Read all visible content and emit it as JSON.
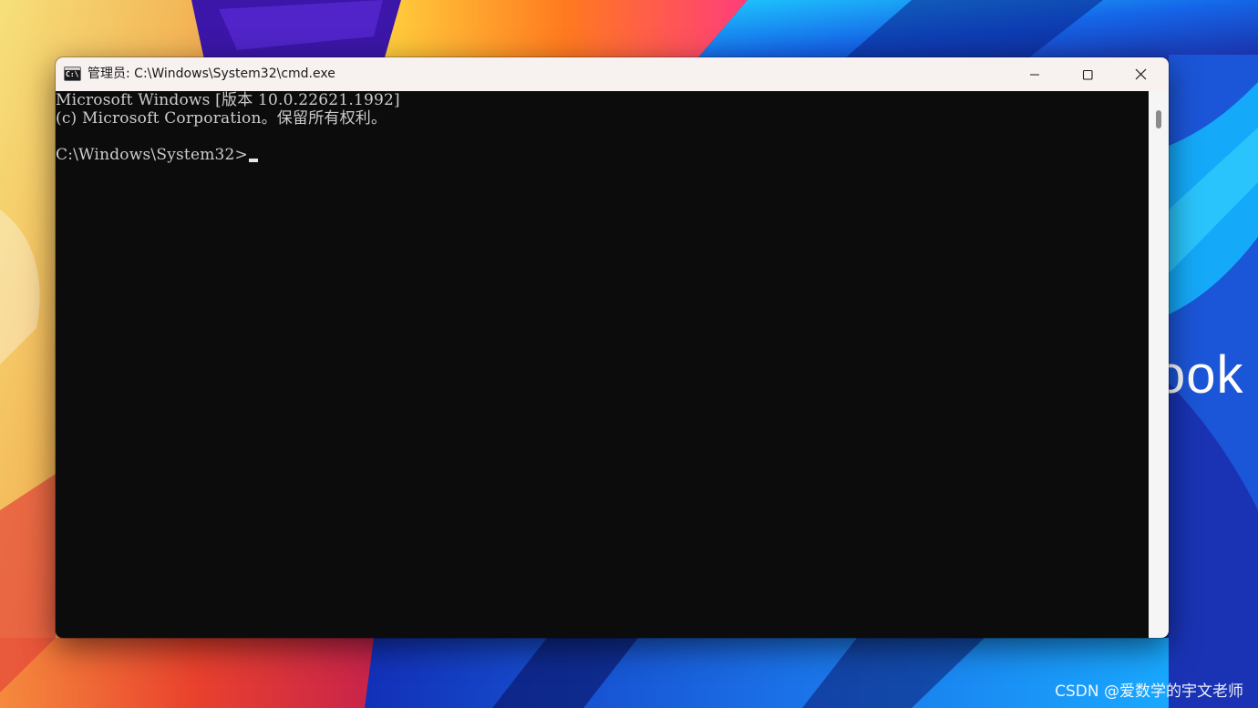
{
  "window": {
    "title": "管理员: C:\\Windows\\System32\\cmd.exe",
    "app_icon": "cmd-console-icon",
    "app_icon_glyph": "C:\\.",
    "buttons": {
      "minimize": "minimize-icon",
      "maximize": "maximize-icon",
      "close": "close-icon"
    }
  },
  "console": {
    "lines": [
      "Microsoft Windows [版本 10.0.22621.1992]",
      "(c) Microsoft Corporation。保留所有权利。",
      "",
      "C:\\Windows\\System32>"
    ],
    "foreground": "#cccccc",
    "background": "#0c0c0c"
  },
  "desktop": {
    "wallpaper_text": "ook",
    "watermark": "CSDN @爱数学的宇文老师"
  }
}
